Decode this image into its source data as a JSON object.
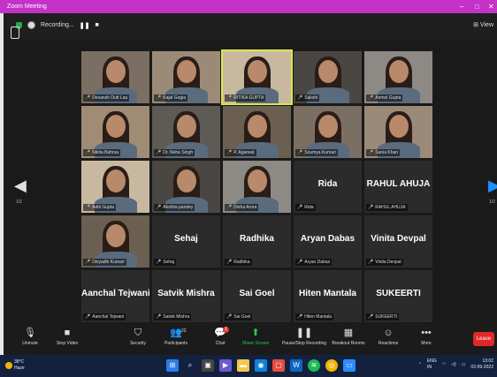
{
  "window": {
    "title": "Zoom Meeting",
    "minimize": "–",
    "maximize": "□",
    "close": "✕"
  },
  "meeting_bar": {
    "recording_label": "Recording...",
    "pause": "❚❚",
    "stop": "■",
    "view_label": "⊞ View"
  },
  "navigation": {
    "left_arrow": "◀",
    "right_arrow": "▶",
    "left_page": "1/2",
    "right_page": "1/2"
  },
  "participants": [
    {
      "name": "Devansh Dutt Lau",
      "type": "photo"
    },
    {
      "name": "Kajal Gogia",
      "type": "photo"
    },
    {
      "name": "RITIKA GUPTA",
      "type": "photo",
      "active": true
    },
    {
      "name": "Sakshi",
      "type": "photo"
    },
    {
      "name": "Anmol Gupta",
      "type": "photo"
    },
    {
      "name": "Nikita Bahrsa",
      "type": "photo"
    },
    {
      "name": "Dr. Neha Singh",
      "type": "photo"
    },
    {
      "name": "P. Agarwal",
      "type": "photo"
    },
    {
      "name": "Soumya Kumari",
      "type": "photo"
    },
    {
      "name": "Sania Khan",
      "type": "photo"
    },
    {
      "name": "Aditi Gupta",
      "type": "photo"
    },
    {
      "name": "Akshita pandey",
      "type": "photo"
    },
    {
      "name": "Disha Arora",
      "type": "photo"
    },
    {
      "name": "Rida",
      "type": "name"
    },
    {
      "name": "RAHUL AHUJA",
      "type": "name"
    },
    {
      "name": "Divyadhi Kumari",
      "type": "photo"
    },
    {
      "name": "Sehaj",
      "type": "name"
    },
    {
      "name": "Radhika",
      "type": "name"
    },
    {
      "name": "Aryan Dabas",
      "type": "name"
    },
    {
      "name": "Vinita Devpal",
      "type": "name"
    },
    {
      "name": "Aanchal Tejwani",
      "type": "name"
    },
    {
      "name": "Satvik Mishra",
      "type": "name"
    },
    {
      "name": "Sai Goel",
      "type": "name"
    },
    {
      "name": "Hiten Mantala",
      "type": "name"
    },
    {
      "name": "SUKEERTI",
      "type": "name"
    }
  ],
  "toolbar": {
    "items": [
      {
        "label": "Unmute",
        "icon": "microphone-muted-icon",
        "glyph": "🎙"
      },
      {
        "label": "Stop Video",
        "icon": "video-icon",
        "glyph": "■"
      },
      {
        "label": "Security",
        "icon": "shield-icon",
        "glyph": "⛉"
      },
      {
        "label": "Participants",
        "icon": "participants-icon",
        "glyph": "👥"
      },
      {
        "label": "Chat",
        "icon": "chat-icon",
        "glyph": "💬"
      },
      {
        "label": "Share Screen",
        "icon": "share-screen-icon",
        "glyph": "⬆"
      },
      {
        "label": "Pause/Stop Recording",
        "icon": "recording-icon",
        "glyph": "❚❚"
      },
      {
        "label": "Breakout Rooms",
        "icon": "breakout-rooms-icon",
        "glyph": "▦"
      },
      {
        "label": "Reactions",
        "icon": "reactions-icon",
        "glyph": "☺"
      },
      {
        "label": "More",
        "icon": "more-icon",
        "glyph": "•••"
      }
    ],
    "participants_count": "22",
    "chat_badge": "1",
    "leave_label": "Leave"
  },
  "taskbar": {
    "weather_temp": "38°C",
    "weather_desc": "Haze",
    "language_top": "ENG",
    "language_bottom": "IN",
    "time": "13:02",
    "date": "02-09-2022"
  },
  "colors": {
    "zoom_titlebar": "#c432c8",
    "active_speaker_outline": "#d6e84a",
    "leave_button": "#e02828",
    "share_green": "#2ecc40"
  }
}
